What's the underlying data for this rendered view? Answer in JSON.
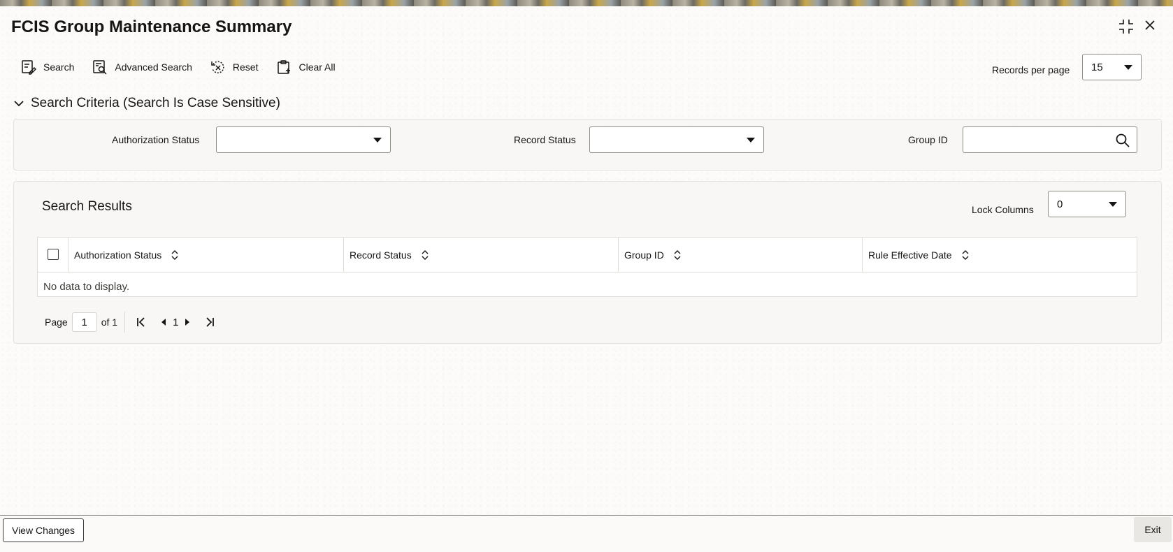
{
  "window": {
    "title": "FCIS Group Maintenance Summary"
  },
  "toolbar": {
    "search_label": "Search",
    "advanced_search_label": "Advanced Search",
    "reset_label": "Reset",
    "clear_all_label": "Clear All",
    "records_per_page_label": "Records per page",
    "records_per_page_value": "15"
  },
  "criteria": {
    "heading": "Search Criteria (Search Is Case Sensitive)",
    "authorization_status_label": "Authorization Status",
    "authorization_status_value": "",
    "record_status_label": "Record Status",
    "record_status_value": "",
    "group_id_label": "Group ID",
    "group_id_value": ""
  },
  "results": {
    "heading": "Search Results",
    "lock_columns_label": "Lock Columns",
    "lock_columns_value": "0",
    "columns": [
      "Authorization Status",
      "Record Status",
      "Group ID",
      "Rule Effective Date"
    ],
    "empty_message": "No data to display."
  },
  "pagination": {
    "page_label": "Page",
    "current_page": "1",
    "of_label": "of 1",
    "page_number": "1"
  },
  "footer": {
    "view_changes_label": "View Changes",
    "exit_label": "Exit"
  }
}
